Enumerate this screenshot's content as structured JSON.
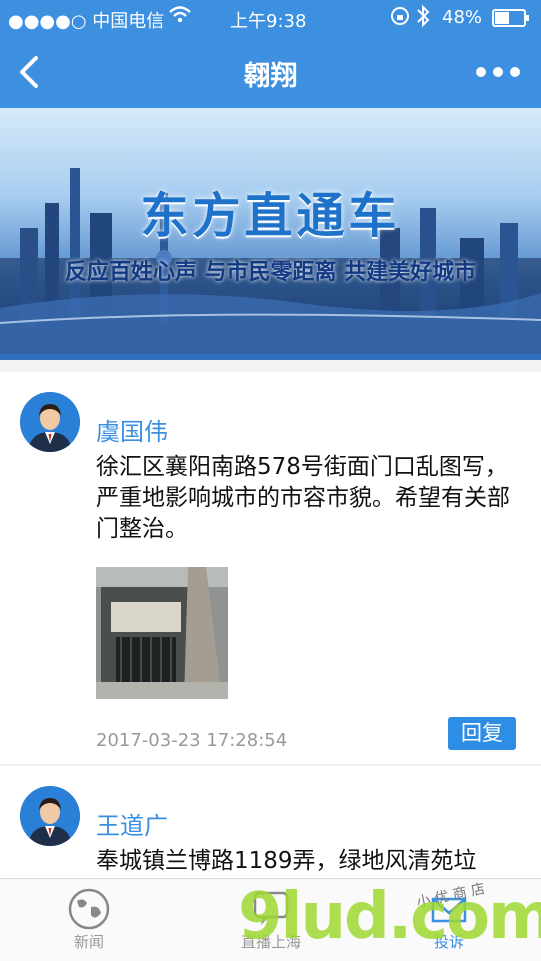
{
  "status_bar": {
    "carrier": "●●●●○ 中国电信",
    "time": "上午9:38",
    "battery": "48%"
  },
  "nav": {
    "title": "翱翔"
  },
  "banner": {
    "title": "东方直通车",
    "subtitle": "反应百姓心声  与市民零距离  共建美好城市"
  },
  "posts": [
    {
      "author": "虞国伟",
      "content": "徐汇区襄阳南路578号街面门口乱图写，严重地影响城市的市容市貌。希望有关部门整治。",
      "time": "2017-03-23 17:28:54",
      "reply_label": "回复"
    },
    {
      "author": "王道广",
      "content": "奉城镇兰博路1189弄，绿地风清苑垃"
    }
  ],
  "tabs": [
    {
      "label": "新闻"
    },
    {
      "label": "直播上海"
    },
    {
      "label": "投诉"
    }
  ],
  "watermark": {
    "text": "9lud.com",
    "shop_text": "小 优 商 店"
  },
  "colors": {
    "primary": "#3d8fe0",
    "reply_button": "#2e8ee6",
    "author": "#3b8fe0"
  }
}
